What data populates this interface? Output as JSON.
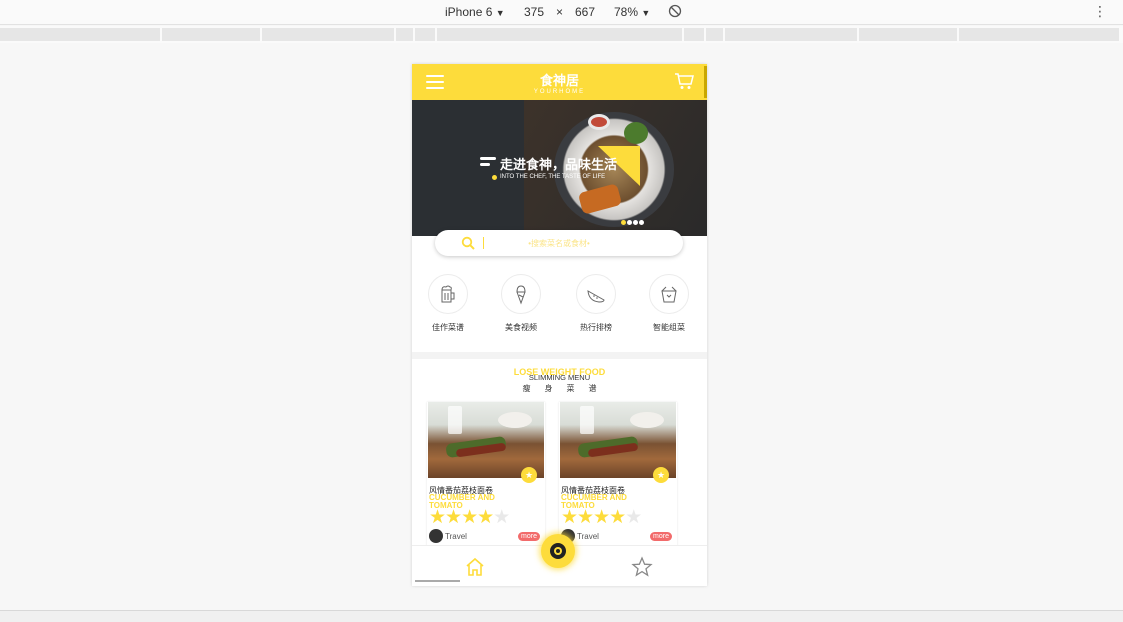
{
  "devtools": {
    "device": "iPhone 6",
    "width": "375",
    "times": "×",
    "height": "667",
    "zoom": "78%",
    "caret": "▼",
    "kebab": "⋮"
  },
  "app": {
    "title": "食神居",
    "subtitle": "YOURHOME",
    "accent": "#fddc3b"
  },
  "banner": {
    "headline": "走进食神，品味生活",
    "tagline": "INTO THE CHEF, THE TASTE OF LIFE",
    "slide_count": 4,
    "active_slide": 1
  },
  "search": {
    "placeholder": "•搜索菜名或食材•"
  },
  "categories": [
    {
      "label": "佳作菜谱",
      "icon": "beer-mug-icon"
    },
    {
      "label": "美食视频",
      "icon": "ice-cream-icon"
    },
    {
      "label": "热行排榜",
      "icon": "watermelon-icon"
    },
    {
      "label": "智能组菜",
      "icon": "takeout-box-icon"
    }
  ],
  "section": {
    "title_bg": "LOSE WEIGHT FOOD",
    "title_en": "SLIMMING MENU",
    "title_cn": "瘦身菜谱"
  },
  "cards": [
    {
      "name": "风情番茄荔枝面卷",
      "name_en": "CUCUMBER AND TOMATO",
      "rating": 4,
      "max_rating": 5,
      "author": "Travel",
      "more": "more",
      "fav": "★"
    },
    {
      "name": "风情番茄荔枝面卷",
      "name_en": "CUCUMBER AND TOMATO",
      "rating": 4,
      "max_rating": 5,
      "author": "Travel",
      "more": "more",
      "fav": "★"
    }
  ],
  "tabbar": {
    "tabs": [
      "home-icon",
      "camera-icon",
      "star-outline-icon"
    ],
    "active": "home-icon"
  }
}
